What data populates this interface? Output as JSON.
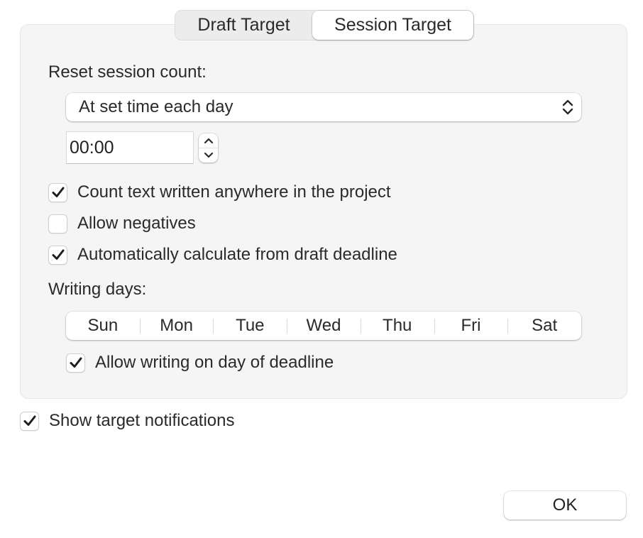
{
  "tabs": [
    {
      "label": "Draft Target",
      "selected": false
    },
    {
      "label": "Session Target",
      "selected": true
    }
  ],
  "session": {
    "reset_label": "Reset session count:",
    "reset_mode": {
      "selected": "At set time each day",
      "icon": "up-down-chevron-icon"
    },
    "reset_time": {
      "value": "00:00",
      "stepper_icons": [
        "chevron-up-icon",
        "chevron-down-icon"
      ]
    },
    "options": [
      {
        "label": "Count text written anywhere in the project",
        "checked": true
      },
      {
        "label": "Allow negatives",
        "checked": false
      },
      {
        "label": "Automatically calculate from draft deadline",
        "checked": true
      }
    ],
    "writing_days_label": "Writing days:",
    "days": [
      "Sun",
      "Mon",
      "Tue",
      "Wed",
      "Thu",
      "Fri",
      "Sat"
    ],
    "allow_deadline_day": {
      "label": "Allow writing on day of deadline",
      "checked": true
    }
  },
  "notifications": {
    "label": "Show target notifications",
    "checked": true
  },
  "ok_label": "OK"
}
